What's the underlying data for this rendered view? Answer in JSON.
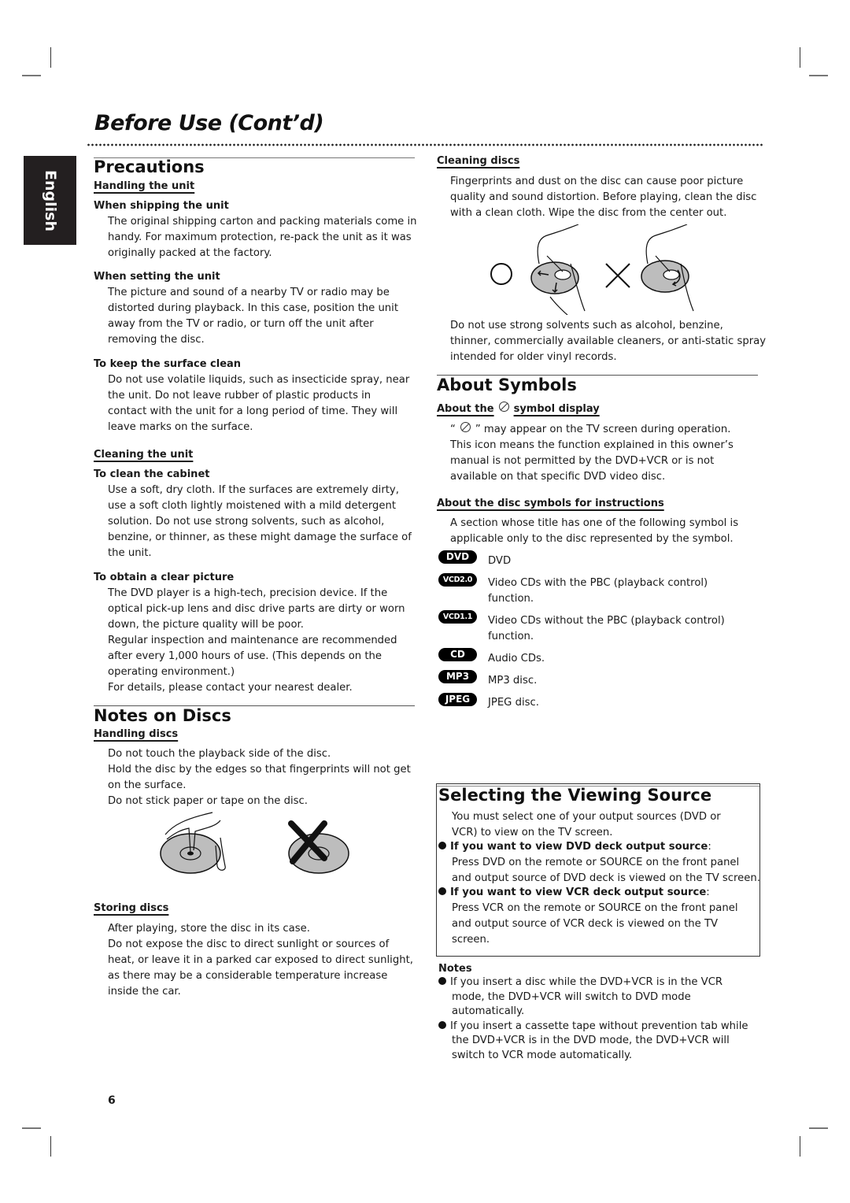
{
  "page": {
    "title": "Before Use (Cont’d)",
    "language_tab": "English",
    "page_number": "6"
  },
  "precautions": {
    "heading": "Precautions",
    "handling_unit": {
      "label": "Handling the unit",
      "shipping": {
        "heading": "When shipping the unit",
        "lines": [
          "The original shipping carton and packing materials come in",
          "handy. For maximum protection, re-pack the unit as it was",
          "originally packed at the factory."
        ]
      },
      "setting": {
        "heading": "When setting the unit",
        "lines": [
          "The picture and sound of a nearby TV or radio may be",
          "distorted during playback. In this case, position the unit",
          "away from the TV or radio, or turn off the unit after",
          "removing the disc."
        ]
      },
      "surface": {
        "heading": "To keep the surface clean",
        "lines": [
          "Do not use volatile liquids, such as insecticide spray, near",
          "the unit. Do not leave rubber of plastic products in",
          "contact with the unit for a long period of time. They will",
          "leave marks on the surface."
        ]
      }
    },
    "cleaning_unit": {
      "label": "Cleaning the unit",
      "cabinet": {
        "heading": "To clean the cabinet",
        "lines": [
          "Use a soft, dry cloth. If the surfaces are extremely dirty,",
          "use a soft cloth lightly moistened with a mild detergent",
          "solution. Do not use strong solvents, such as alcohol,",
          "benzine, or thinner, as these might damage the surface of",
          "the unit."
        ]
      },
      "picture": {
        "heading": "To obtain a clear picture",
        "lines": [
          "The DVD player is a high-tech, precision device. If the",
          "optical pick-up lens and disc drive parts are dirty or worn",
          "down, the picture quality will be poor.",
          "Regular inspection and maintenance are recommended",
          "after every 1,000 hours of use. (This depends on the",
          "operating environment.)",
          "For details, please contact your nearest dealer."
        ]
      }
    }
  },
  "notes_on_discs": {
    "heading": "Notes on Discs",
    "handling": {
      "label": "Handling discs",
      "lines": [
        "Do not touch the playback side of the disc.",
        "Hold the disc by the edges so that fingerprints will not get",
        "on the surface.",
        "Do not stick paper or tape on the disc."
      ]
    },
    "storing": {
      "label": "Storing discs",
      "lines": [
        "After playing, store the disc in its case.",
        "Do not expose the disc to direct sunlight or sources of",
        "heat, or leave it in a parked car exposed to direct sunlight,",
        "as there may be a considerable temperature increase",
        "inside the car."
      ]
    },
    "cleaning": {
      "label": "Cleaning discs",
      "lines": [
        "Fingerprints and dust on the disc can cause poor picture",
        "quality and sound distortion. Before playing, clean the disc",
        "with a clean cloth. Wipe the disc from the center out."
      ],
      "warning_lines": [
        "Do not use strong solvents such as alcohol, benzine,",
        "thinner, commercially available cleaners, or anti-static spray",
        "intended for older vinyl records."
      ]
    }
  },
  "about_symbols": {
    "heading": "About Symbols",
    "symbol_display": {
      "label_before": "About the",
      "label_after": "symbol display",
      "first_line_open": "“",
      "first_line_rest": "” may appear on the TV screen during operation.",
      "lines": [
        "This icon means the function explained in this owner’s",
        "manual is not permitted by the DVD+VCR or is not",
        "available on that specific DVD video disc."
      ]
    },
    "disc_symbols": {
      "label": "About the disc symbols for instructions",
      "lines": [
        "A section whose title has one of the following symbol is",
        "applicable only to the disc represented by the symbol."
      ],
      "items": [
        {
          "badge": "DVD",
          "desc": [
            "DVD"
          ]
        },
        {
          "badge": "VCD2.0",
          "desc": [
            "Video CDs with the PBC (playback control)",
            "function."
          ]
        },
        {
          "badge": "VCD1.1",
          "desc": [
            "Video CDs without the PBC (playback control)",
            "function."
          ]
        },
        {
          "badge": "CD",
          "desc": [
            "Audio CDs."
          ]
        },
        {
          "badge": "MP3",
          "desc": [
            "MP3 disc."
          ]
        },
        {
          "badge": "JPEG",
          "desc": [
            "JPEG disc."
          ]
        }
      ]
    }
  },
  "viewing_source": {
    "heading": "Selecting the Viewing Source",
    "intro": [
      "You must select one of your output sources (DVD or",
      "VCR) to view on the TV screen."
    ],
    "dvd": {
      "heading": "If you want to view DVD deck output source",
      "colon": ":",
      "lines": [
        "Press DVD on the remote or SOURCE on the front panel",
        "and output source of DVD deck is viewed on the TV screen."
      ]
    },
    "vcr": {
      "heading": "If you want to view VCR deck output source",
      "colon": ":",
      "lines": [
        "Press VCR on the remote or SOURCE on the front panel",
        "and output source of VCR deck is viewed on the TV",
        "screen."
      ]
    }
  },
  "notes": {
    "heading": "Notes",
    "items": [
      [
        "If you insert a disc while the DVD+VCR is in the VCR",
        "mode, the DVD+VCR will switch to DVD mode",
        "automatically."
      ],
      [
        "If you insert a cassette tape without prevention tab while",
        "the DVD+VCR is in the DVD mode, the DVD+VCR will",
        "switch to VCR mode automatically."
      ]
    ]
  }
}
